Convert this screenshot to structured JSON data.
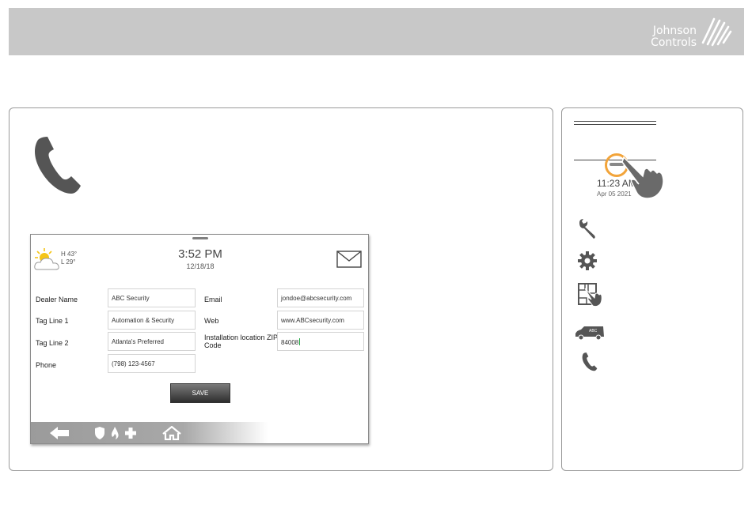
{
  "brand": {
    "line1": "Johnson",
    "line2": "Controls"
  },
  "device": {
    "weather": {
      "high": "H 43°",
      "low": "L 29°"
    },
    "clock": {
      "time": "3:52 PM",
      "date": "12/18/18"
    },
    "form": {
      "dealer_name": {
        "label": "Dealer Name",
        "value": "ABC Security"
      },
      "tag_line_1": {
        "label": "Tag Line 1",
        "value": "Automation & Security"
      },
      "tag_line_2": {
        "label": "Tag Line 2",
        "value": "Atlanta's Preferred"
      },
      "phone": {
        "label": "Phone",
        "value": "(798) 123-4567"
      },
      "email": {
        "label": "Email",
        "value": "jondoe@abcsecurity.com"
      },
      "web": {
        "label": "Web",
        "value": "www.ABCsecurity.com"
      },
      "zip": {
        "label": "Installation location ZIP Code",
        "value": "84008"
      }
    },
    "save_label": "SAVE",
    "nav_icons": [
      "back-arrow-icon",
      "shield-icon",
      "flame-icon",
      "plus-icon",
      "home-icon"
    ]
  },
  "side": {
    "time": "11:23 AM",
    "date": "Apr 05 2021",
    "icons": [
      "wrench-icon",
      "gear-icon",
      "floorplan-touch-icon",
      "dealer-van-icon",
      "phone-icon"
    ],
    "van_text": "ABC"
  },
  "colors": {
    "banner": "#c8c8c8",
    "ring": "#f2a43a",
    "icon": "#555555"
  }
}
